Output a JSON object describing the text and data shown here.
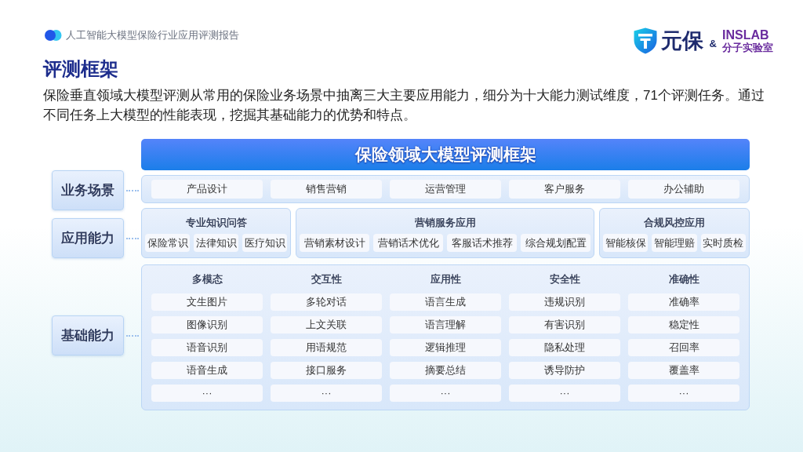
{
  "header": {
    "report_title": "人工智能大模型保险行业应用评测报告"
  },
  "logo": {
    "brand": "元保",
    "ampersand": "&",
    "partner": "INSLAB",
    "partner_sub": "分子实验室"
  },
  "section_title": "评测框架",
  "intro": "保险垂直领域大模型评测从常用的保险业务场景中抽离三大主要应用能力，细分为十大能力测试维度，71个评测任务。通过不同任务上大模型的性能表现，挖掘其基础能力的优势和特点。",
  "framework": {
    "title": "保险领域大模型评测框架",
    "layers": [
      {
        "label": "业务场景",
        "kind": "scenarios",
        "items": [
          "产品设计",
          "销售营销",
          "运营管理",
          "客户服务",
          "办公辅助"
        ]
      },
      {
        "label": "应用能力",
        "kind": "groups",
        "groups": [
          {
            "title": "专业知识问答",
            "items": [
              "保险常识",
              "法律知识",
              "医疗知识"
            ]
          },
          {
            "title": "营销服务应用",
            "items": [
              "营销素材设计",
              "营销话术优化",
              "客服话术推荐",
              "综合规划配置"
            ]
          },
          {
            "title": "合规风控应用",
            "items": [
              "智能核保",
              "智能理赔",
              "实时质检"
            ]
          }
        ]
      },
      {
        "label": "基础能力",
        "kind": "columns",
        "columns": [
          {
            "title": "多模态",
            "items": [
              "文生图片",
              "图像识别",
              "语音识别",
              "语音生成",
              "···"
            ]
          },
          {
            "title": "交互性",
            "items": [
              "多轮对话",
              "上文关联",
              "用语规范",
              "接口服务",
              "···"
            ]
          },
          {
            "title": "应用性",
            "items": [
              "语言生成",
              "语言理解",
              "逻辑推理",
              "摘要总结",
              "···"
            ]
          },
          {
            "title": "安全性",
            "items": [
              "违规识别",
              "有害识别",
              "隐私处理",
              "诱导防护",
              "···"
            ]
          },
          {
            "title": "准确性",
            "items": [
              "准确率",
              "稳定性",
              "召回率",
              "覆盖率",
              "···"
            ]
          }
        ]
      }
    ]
  }
}
